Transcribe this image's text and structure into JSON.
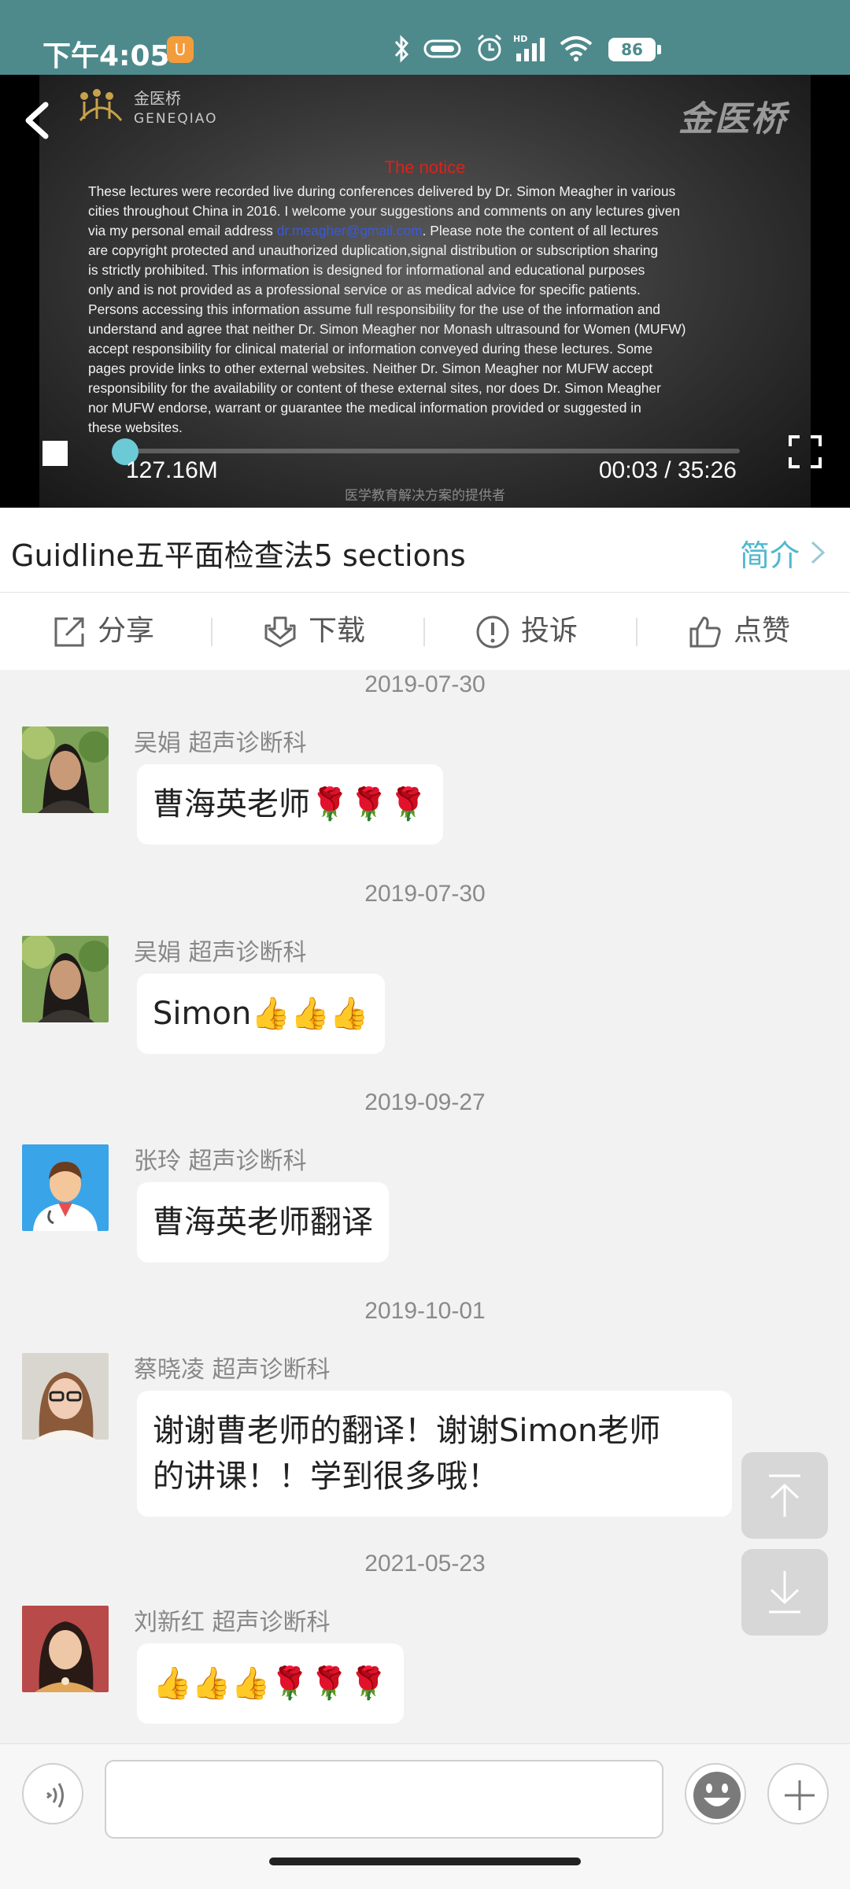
{
  "status_bar": {
    "time": "下午4:05",
    "battery": "86",
    "icons": [
      "uc-browser-icon",
      "bluetooth-icon",
      "vibrate-icon",
      "alarm-icon",
      "hd-signal-icon",
      "wifi-icon",
      "battery-icon"
    ]
  },
  "video": {
    "logo_cn": "金医桥",
    "logo_en": "GENEQIAO",
    "watermark": "金医桥",
    "notice_title": "The notice",
    "notice_lines": [
      "These lectures were recorded  live during conferences delivered by Dr. Simon Meagher in various",
      "cities throughout China in 2016. I welcome your suggestions and comments on any lectures given",
      "via my personal email address ",
      "dr.meagher@gmail.com",
      ". Please note the content of all lectures",
      " are copyright protected and unauthorized duplication,signal distribution or subscription sharing",
      "is strictly prohibited. This information is designed for informational and educational purposes",
      "only and is not provided as a professional service or as medical advice for specific patients.",
      "Persons accessing this information assume full responsibility for the use of the information and",
      "understand and agree that neither Dr. Simon Meagher nor Monash ultrasound for Women (MUFW)",
      "accept responsibility for clinical material or information conveyed during these lectures.  Some",
      "pages provide links to other external websites. Neither Dr. Simon Meagher nor MUFW accept",
      "responsibility for the availability or content of these external sites, nor does Dr. Simon Meagher",
      "nor MUFW endorse, warrant or guarantee the medical information provided or suggested in",
      "these websites."
    ],
    "slide_footer": "医学教育解决方案的提供者",
    "size": "127.16M",
    "time": "00:03 / 35:26",
    "progress_fraction": 0.0014
  },
  "title_row": {
    "title": "Guidline五平面检查法5 sections",
    "intro_label": "简介"
  },
  "actions": [
    {
      "label": "分享",
      "icon": "share-icon"
    },
    {
      "label": "下载",
      "icon": "download-icon"
    },
    {
      "label": "投诉",
      "icon": "complaint-icon"
    },
    {
      "label": "点赞",
      "icon": "thumbs-up-icon"
    }
  ],
  "comments": [
    {
      "date": "2019-07-30",
      "sender": "吴娟  超声诊断科",
      "text": "曹海英老师🌹🌹🌹"
    },
    {
      "date": "2019-07-30",
      "sender": "吴娟  超声诊断科",
      "text": "Simon👍👍👍"
    },
    {
      "date": "2019-09-27",
      "sender": "张玲  超声诊断科",
      "text": "曹海英老师翻译"
    },
    {
      "date": "2019-10-01",
      "sender": "蔡晓凌  超声诊断科",
      "text_line1": "谢谢曹老师的翻译！谢谢Simon老师",
      "text_line2": "的讲课！！学到很多哦！"
    },
    {
      "date": "2021-05-23",
      "sender": "刘新红  超声诊断科",
      "text": "👍👍👍🌹🌹🌹"
    }
  ],
  "input": {
    "placeholder": ""
  },
  "colors": {
    "status_bar": "#4e8a8c",
    "accent": "#4fb8cf",
    "progress": "#6cc9d6",
    "notice_title": "#d9231c"
  }
}
